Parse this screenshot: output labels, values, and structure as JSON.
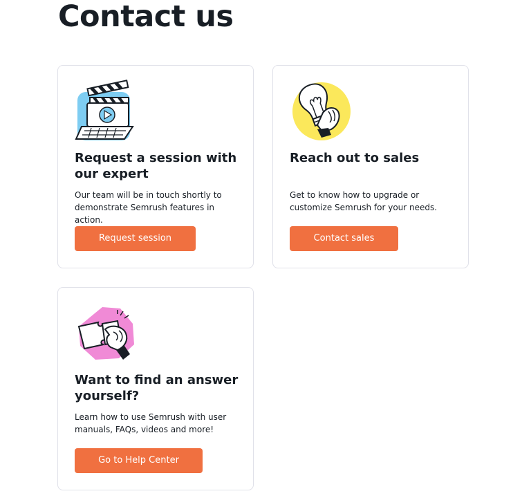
{
  "page": {
    "title": "Contact us"
  },
  "cards": [
    {
      "title": "Request a session with our expert",
      "text": "Our team will be in touch shortly to demonstrate Semrush features in action.",
      "button_label": "Request session",
      "illustration": "clapperboard-laptop-icon",
      "accent_color": "#7ecdf2"
    },
    {
      "title": "Reach out to sales",
      "text": "Get to know how to upgrade or customize Semrush for your needs.",
      "button_label": "Contact sales",
      "illustration": "lightbulb-hand-icon",
      "accent_color": "#fbe85b"
    },
    {
      "title": "Want to find an answer yourself?",
      "text": "Learn how to use Semrush with user manuals, FAQs, videos and more!",
      "button_label": "Go to Help Center",
      "illustration": "puzzle-hand-icon",
      "accent_color": "#f08ad6"
    }
  ],
  "colors": {
    "button": "#f07040",
    "card_border": "#e0e1e9",
    "text": "#181e25"
  }
}
